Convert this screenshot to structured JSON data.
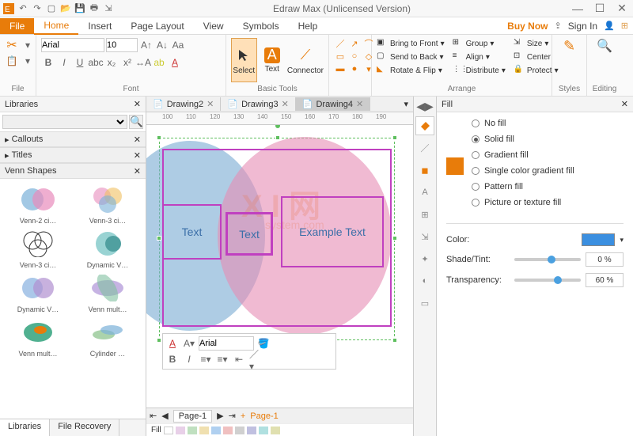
{
  "app": {
    "title": "Edraw Max (Unlicensed Version)"
  },
  "menu": {
    "file": "File",
    "items": [
      "Home",
      "Insert",
      "Page Layout",
      "View",
      "Symbols",
      "Help"
    ],
    "active": "Home",
    "buy": "Buy Now",
    "signin": "Sign In"
  },
  "ribbon": {
    "file_group": "File",
    "font_group": "Font",
    "basic_tools": "Basic Tools",
    "arrange_group": "Arrange",
    "styles": "Styles",
    "editing": "Editing",
    "font_name": "Arial",
    "font_size": "10",
    "select": "Select",
    "text": "Text",
    "connector": "Connector",
    "bring_front": "Bring to Front",
    "send_back": "Send to Back",
    "rotate_flip": "Rotate & Flip",
    "group": "Group",
    "align": "Align",
    "distribute": "Distribute",
    "size": "Size",
    "center": "Center",
    "protect": "Protect"
  },
  "left": {
    "title": "Libraries",
    "callouts": "Callouts",
    "titles": "Titles",
    "venn": "Venn Shapes",
    "shapes": [
      "Venn-2 ci…",
      "Venn-3 ci…",
      "Venn-3 ci…",
      "Dynamic V…",
      "Dynamic V…",
      "Venn mult…",
      "Venn mult…",
      "Cylinder …"
    ],
    "tab1": "Libraries",
    "tab2": "File Recovery"
  },
  "tabs": {
    "items": [
      "Drawing2",
      "Drawing3",
      "Drawing4"
    ],
    "active": "Drawing4"
  },
  "ruler": [
    "100",
    "110",
    "120",
    "130",
    "140",
    "150",
    "160",
    "170",
    "180",
    "190"
  ],
  "canvas": {
    "text1": "Text",
    "text2": "Text",
    "text3": "Example Text"
  },
  "mini": {
    "font": "Arial"
  },
  "pages": {
    "p1": "Page-1",
    "p1b": "Page-1",
    "fill": "Fill"
  },
  "right": {
    "title": "Fill",
    "nofill": "No fill",
    "solid": "Solid fill",
    "gradient": "Gradient fill",
    "single_grad": "Single color gradient fill",
    "pattern": "Pattern fill",
    "picture": "Picture or texture fill",
    "color": "Color:",
    "shade": "Shade/Tint:",
    "transparency": "Transparency:",
    "shade_val": "0 %",
    "trans_val": "60 %"
  }
}
